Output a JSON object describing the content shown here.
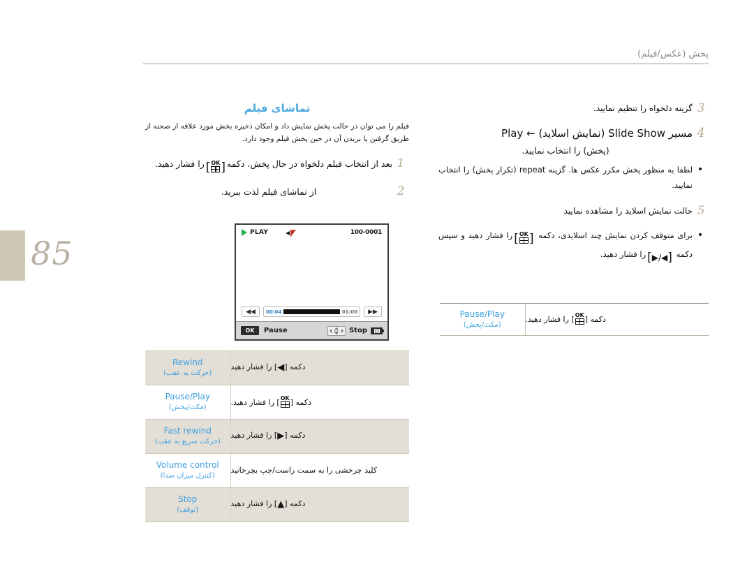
{
  "header": {
    "running_head": "پخش (عکس/فیلم)"
  },
  "page": {
    "number": "85"
  },
  "left_column": {
    "section_title": "تماشای فیلم",
    "intro": "فیلم را می توان در حالت پخش نمایش داد و امکان ذخیره بخش مورد علاقه از صحنه از طریق گرفتن یا بریدن آن در حین پخش فیلم وجود دارد.",
    "steps": [
      {
        "num": "1",
        "text_before": "بعد از انتخاب فیلم دلخواه در حال پخش. دکمه",
        "key": "OK",
        "text_after": "را فشار دهید."
      },
      {
        "num": "2",
        "text": "از تماشای فیلم لذت ببرید."
      }
    ]
  },
  "right_column": {
    "steps": [
      {
        "num": "3",
        "text": "گزینه دلخواه را تنظیم نمایید."
      },
      {
        "num": "4",
        "text_line1": "مسیر Slide Show (نمایش اسلاید) ← Play",
        "text_line2": "(پخش) را انتخاب نمایید."
      },
      {
        "num": "5",
        "text": "حالت نمایش اسلاید را مشاهده نمایید"
      }
    ],
    "bullets": [
      {
        "text": "لطفا به منظور پخش مکرر عکس ها. گزینه repeat (تکرار پخش) را انتخاب نمایید."
      },
      {
        "text_before": "برای متوقف کردن نمایش چند اسلایدی، دکمه",
        "key1": "OK",
        "text_mid": "را فشار دهید و سپس دکمه",
        "key2": "◀/▶",
        "text_after": "را فشار دهید."
      }
    ]
  },
  "lcd": {
    "mode_label": "PLAY",
    "file_number": "100-0001",
    "time_current": "00:04",
    "time_total": "01:00",
    "rewind_glyph": "◀◀",
    "forward_glyph": "▶▶",
    "ok_chip": "OK",
    "pause_label": "Pause",
    "stop_label": "Stop"
  },
  "table_left": {
    "rows": [
      {
        "en": "Rewind",
        "fa": "(حرکت به عقب)",
        "desc_before": "دکمه [",
        "desc_key": "◀",
        "desc_after": "] را فشار دهید",
        "shade": true
      },
      {
        "en": "Pause/Play",
        "fa": "(مکث/پخش)",
        "desc_before": "دکمه [",
        "desc_key": "OK",
        "desc_after": "] را فشار دهید.",
        "shade": false
      },
      {
        "en": "Fast rewind",
        "fa": "(حرکت سریع به عقب)",
        "desc_before": "دکمه [",
        "desc_key": "▶",
        "desc_after": "] را فشار دهید",
        "shade": true
      },
      {
        "en": "Volume control",
        "fa": "(کنترل میزان صدا)",
        "desc_full": "کلید چرخشی را به سمت راست/چپ بچرخانید",
        "shade": false
      },
      {
        "en": "Stop",
        "fa": "(توقف)",
        "desc_before": "دکمه [",
        "desc_key": "▲",
        "desc_after": "] را فشار دهید",
        "shade": true
      }
    ]
  },
  "table_right": {
    "row": {
      "en": "Pause/Play",
      "fa": "(مکث/پخش)",
      "desc_before": "دکمه [",
      "desc_key": "OK",
      "desc_after": "] را فشار دهید."
    }
  },
  "colors": {
    "accent_blue": "#3d9fe0",
    "title_blue": "#4aa8e0",
    "step_number": "#b9ad93",
    "page_swatch": "#cfc6b4",
    "table_shade": "#e3dfd7",
    "play_green": "#29b24a"
  }
}
